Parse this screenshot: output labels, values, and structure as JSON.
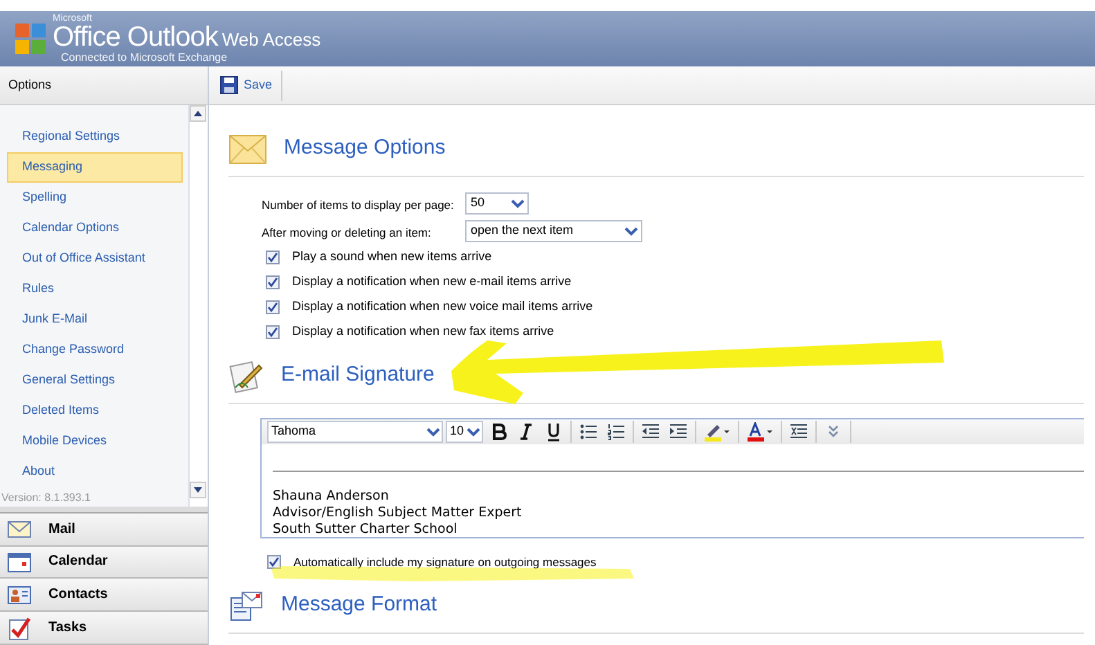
{
  "header": {
    "brand_small": "Microsoft",
    "brand_office": "Office Outlook",
    "brand_web": "Web Access",
    "subtitle": "Connected to Microsoft Exchange"
  },
  "sidebar": {
    "title": "Options",
    "items": [
      {
        "label": "Regional Settings",
        "selected": false
      },
      {
        "label": "Messaging",
        "selected": true
      },
      {
        "label": "Spelling",
        "selected": false
      },
      {
        "label": "Calendar Options",
        "selected": false
      },
      {
        "label": "Out of Office Assistant",
        "selected": false
      },
      {
        "label": "Rules",
        "selected": false
      },
      {
        "label": "Junk E-Mail",
        "selected": false
      },
      {
        "label": "Change Password",
        "selected": false
      },
      {
        "label": "General Settings",
        "selected": false
      },
      {
        "label": "Deleted Items",
        "selected": false
      },
      {
        "label": "Mobile Devices",
        "selected": false
      },
      {
        "label": "About",
        "selected": false
      }
    ],
    "version": "Version: 8.1.393.1",
    "modules": [
      {
        "kind": "mail",
        "label": "Mail"
      },
      {
        "kind": "calendar",
        "label": "Calendar"
      },
      {
        "kind": "contacts",
        "label": "Contacts"
      },
      {
        "kind": "tasks",
        "label": "Tasks"
      }
    ]
  },
  "toolbar": {
    "save": "Save"
  },
  "message_options": {
    "title": "Message Options",
    "items_per_page": {
      "label": "Number of items to display per page:",
      "value": "50"
    },
    "after_move": {
      "label": "After moving or deleting an item:",
      "value": "open the next item"
    },
    "checkboxes": [
      {
        "label": "Play a sound when new items arrive",
        "checked": true
      },
      {
        "label": "Display a notification when new e-mail items arrive",
        "checked": true
      },
      {
        "label": "Display a notification when new voice mail items arrive",
        "checked": true
      },
      {
        "label": "Display a notification when new fax items arrive",
        "checked": true
      }
    ]
  },
  "signature": {
    "title": "E-mail Signature",
    "font": "Tahoma",
    "size": "10",
    "lines": [
      "Shauna Anderson",
      "Advisor/English Subject Matter Expert",
      "South Sutter Charter School"
    ],
    "auto_include": {
      "label": "Automatically include my signature on outgoing messages",
      "checked": true
    }
  },
  "message_format": {
    "title": "Message Format"
  }
}
